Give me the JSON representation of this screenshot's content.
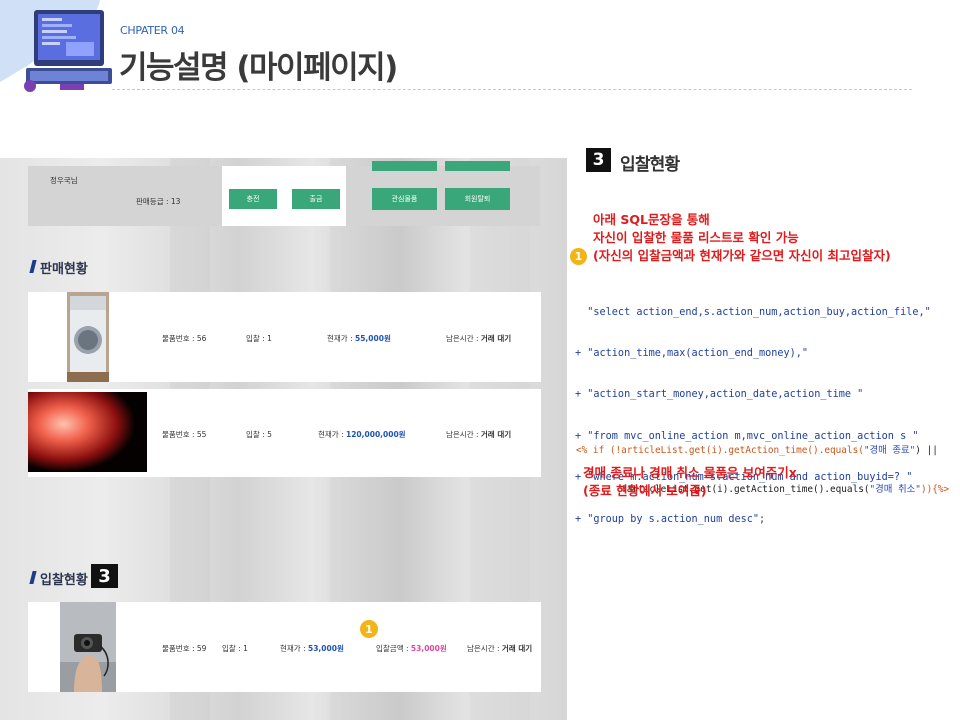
{
  "header": {
    "chapter": "CHPATER 04",
    "title": "기능설명 (마이페이지)"
  },
  "screenshot": {
    "profile": {
      "name": "정우국님",
      "grade": "판매등급 : 13",
      "charge_button": "충전",
      "withdraw_button": "출금",
      "wishlist_button": "관심물품",
      "withdrawal_button": "회원탈퇴"
    },
    "sales_section": {
      "title": "판매현황",
      "items": [
        {
          "item_no": "물품번호 : 56",
          "bids": "입찰 : 1",
          "price_label": "현재가 : ",
          "price": "55,000원",
          "time_label": "남은시간 : ",
          "time": "거래 대기"
        },
        {
          "item_no": "물품번호 : 55",
          "bids": "입찰 : 5",
          "price_label": "현재가 : ",
          "price": "120,000,000원",
          "time_label": "남은시간 : ",
          "time": "거래 대기"
        }
      ]
    },
    "bid_section": {
      "title": "입찰현황",
      "badge": "3",
      "item": {
        "item_no": "물품번호 : 59",
        "bids": "입찰 : 1",
        "price_label": "현재가 : ",
        "price": "53,000원",
        "bid_amount_label": "입찰금액 : ",
        "bid_amount": "53,000원",
        "time_label": "남은시간 : ",
        "time": "거래 대기"
      },
      "marker": "1"
    }
  },
  "explanation": {
    "badge": "3",
    "title": "입찰현황",
    "marker": "1",
    "note_lines": [
      "아래 SQL문장을 통해",
      "자신이 입찰한 물품 리스트로 확인 가능",
      "(자신의 입찰금액과 현재가와 같으면 자신이 최고입찰자)"
    ],
    "sql_lines": [
      "  \"select action_end,s.action_num,action_buy,action_file,\"",
      "+ \"action_time,max(action_end_money),\"",
      "+ \"action_start_money,action_date,action_time \"",
      "+ \"from mvc_online_action m,mvc_online_action_action s \"",
      "+ \"where m.action_num=s.action_num and action_buyid=? \"",
      "+ \"group by s.action_num desc\";"
    ],
    "jsp_line1_pre": "<% if (!articleList.get(i).getAction_time().equals(",
    "jsp_line1_str": "\"경매 종료\"",
    "jsp_line1_post": ") ||",
    "jsp_line2_pre": "        !articleList.get(i).getAction_time().equals(",
    "jsp_line2_str": "\"경매 취소\"",
    "jsp_line2_post": ")){%>",
    "footer_lines": [
      "경매 종료나 경매 취소 물품은 보여주기x",
      "(종료 현황에서 보여줌)"
    ]
  },
  "colors": {
    "accent_blue": "#1f3c88",
    "button_green": "#3aa77a",
    "note_red": "#e01b1b",
    "marker_yellow": "#f3b417"
  }
}
